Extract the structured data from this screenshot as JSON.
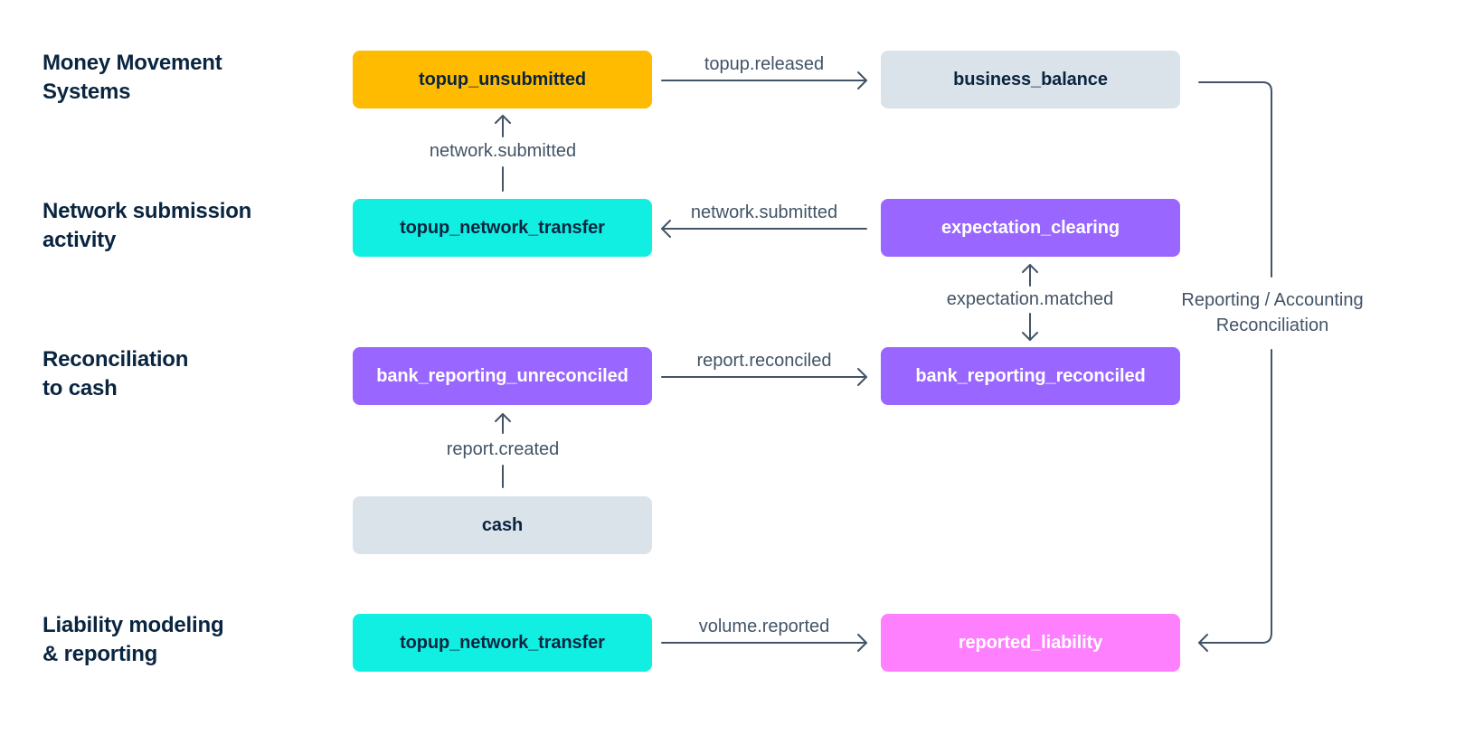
{
  "sections": [
    {
      "id": "money-movement-systems",
      "lines": [
        "Money Movement",
        "Systems"
      ]
    },
    {
      "id": "network-submission-activity",
      "lines": [
        "Network submission",
        "activity"
      ]
    },
    {
      "id": "reconciliation-to-cash",
      "lines": [
        "Reconciliation",
        "to cash"
      ]
    },
    {
      "id": "liability-modeling-reporting",
      "lines": [
        "Liability modeling",
        "& reporting"
      ]
    }
  ],
  "nodes": {
    "topup_unsubmitted": {
      "label": "topup_unsubmitted",
      "fill": "#ffbb00",
      "text_color": "#0a2540"
    },
    "business_balance": {
      "label": "business_balance",
      "fill": "#dbe3ea",
      "text_color": "#0a2540"
    },
    "topup_network_transfer": {
      "label": "topup_network_transfer",
      "fill": "#11efe3",
      "text_color": "#0a2540"
    },
    "expectation_clearing": {
      "label": "expectation_clearing",
      "fill": "#9966ff",
      "text_color": "#ffffff"
    },
    "bank_reporting_unreconciled": {
      "label": "bank_reporting_unreconciled",
      "fill": "#9966ff",
      "text_color": "#ffffff"
    },
    "bank_reporting_reconciled": {
      "label": "bank_reporting_reconciled",
      "fill": "#9966ff",
      "text_color": "#ffffff"
    },
    "cash": {
      "label": "cash",
      "fill": "#dbe3ea",
      "text_color": "#0a2540"
    },
    "topup_network_transfer_liability": {
      "label": "topup_network_transfer",
      "fill": "#11efe3",
      "text_color": "#0a2540"
    },
    "reported_liability": {
      "label": "reported_liability",
      "fill": "#ff80ff",
      "text_color": "#ffffff"
    }
  },
  "edges": {
    "topup_released": {
      "label": "topup.released",
      "from": "topup_unsubmitted",
      "to": "business_balance"
    },
    "network_submitted_up": {
      "label": "network.submitted",
      "from": "topup_network_transfer",
      "to": "topup_unsubmitted"
    },
    "network_submitted_left": {
      "label": "network.submitted",
      "from": "expectation_clearing",
      "to": "topup_network_transfer"
    },
    "expectation_matched": {
      "label": "expectation.matched",
      "from": "bank_reporting_reconciled",
      "to": "expectation_clearing",
      "bidirectional": true
    },
    "report_reconciled": {
      "label": "report.reconciled",
      "from": "bank_reporting_unreconciled",
      "to": "bank_reporting_reconciled"
    },
    "report_created": {
      "label": "report.created",
      "from": "cash",
      "to": "bank_reporting_unreconciled"
    },
    "volume_reported": {
      "label": "volume.reported",
      "from": "topup_network_transfer_liability",
      "to": "reported_liability"
    },
    "reporting_accounting": {
      "label_lines": [
        "Reporting / Accounting",
        "Reconciliation"
      ],
      "from": "business_balance",
      "to": "reported_liability"
    }
  },
  "style": {
    "label_color": "#0a2540",
    "connector_color": "#425466"
  }
}
